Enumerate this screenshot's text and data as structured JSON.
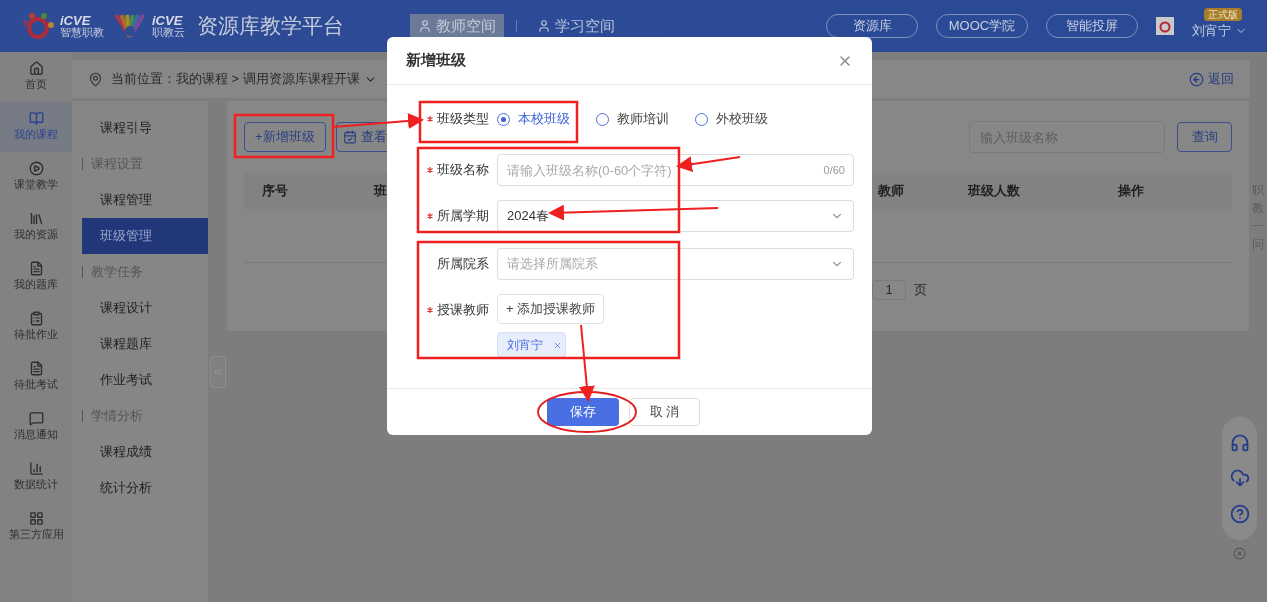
{
  "header": {
    "logos": [
      {
        "mark": "iCVE",
        "caption": "智慧职教"
      },
      {
        "mark": "iCVE",
        "caption": "职教云"
      }
    ],
    "title": "资源库教学平台",
    "spaces": [
      {
        "label": "教师空间",
        "selected": true
      },
      {
        "label": "学习空间",
        "selected": false
      }
    ],
    "links": [
      "资源库",
      "MOOC学院",
      "智能投屏"
    ],
    "badge": "正式版",
    "user": "刘宵宁"
  },
  "nav": [
    {
      "label": "首页",
      "selected": false
    },
    {
      "label": "我的课程",
      "selected": true
    },
    {
      "label": "课堂教学",
      "selected": false
    },
    {
      "label": "我的资源",
      "selected": false
    },
    {
      "label": "我的题库",
      "selected": false
    },
    {
      "label": "待批作业",
      "selected": false
    },
    {
      "label": "待批考试",
      "selected": false
    },
    {
      "label": "消息通知",
      "selected": false
    },
    {
      "label": "数据统计",
      "selected": false
    },
    {
      "label": "第三方应用",
      "selected": false
    }
  ],
  "breadcrumb": {
    "prefix": "当前位置：",
    "path": "我的课程 > 调用资源库课程开课",
    "back": "返回"
  },
  "menu": [
    {
      "kind": "item",
      "label": "课程引导",
      "selected": false
    },
    {
      "kind": "group",
      "label": "课程设置"
    },
    {
      "kind": "item",
      "label": "课程管理",
      "selected": false
    },
    {
      "kind": "item",
      "label": "班级管理",
      "selected": true
    },
    {
      "kind": "group",
      "label": "教学任务"
    },
    {
      "kind": "item",
      "label": "课程设计",
      "selected": false
    },
    {
      "kind": "item",
      "label": "课程题库",
      "selected": false
    },
    {
      "kind": "item",
      "label": "作业考试",
      "selected": false
    },
    {
      "kind": "group",
      "label": "学情分析"
    },
    {
      "kind": "item",
      "label": "课程成绩",
      "selected": false
    },
    {
      "kind": "item",
      "label": "统计分析",
      "selected": false
    }
  ],
  "toolbar": {
    "add": "+新增班级",
    "view": "查看",
    "search_placeholder": "输入班级名称",
    "query": "查询"
  },
  "table": {
    "columns": [
      "序号",
      "班",
      "教师",
      "班级人数",
      "操作"
    ]
  },
  "pagination": {
    "page": "1",
    "unit": "页"
  },
  "side_note": "职教一问",
  "dialog": {
    "title": "新增班级",
    "fields": [
      {
        "kind": "radio",
        "label": "班级类型",
        "required": true,
        "options": [
          {
            "label": "本校班级",
            "selected": true
          },
          {
            "label": "教师培训",
            "selected": false
          },
          {
            "label": "外校班级",
            "selected": false
          }
        ]
      },
      {
        "kind": "text",
        "label": "班级名称",
        "required": true,
        "placeholder": "请输入班级名称(0-60个字符)",
        "counter": "0/60"
      },
      {
        "kind": "select",
        "label": "所属学期",
        "required": true,
        "value": "2024春"
      },
      {
        "kind": "select",
        "label": "所属院系",
        "required": false,
        "placeholder": "请选择所属院系"
      },
      {
        "kind": "teachers",
        "label": "授课教师",
        "required": true,
        "add": "+ 添加授课教师",
        "tags": [
          "刘宵宁"
        ]
      }
    ],
    "save": "保存",
    "cancel": "取 消"
  }
}
